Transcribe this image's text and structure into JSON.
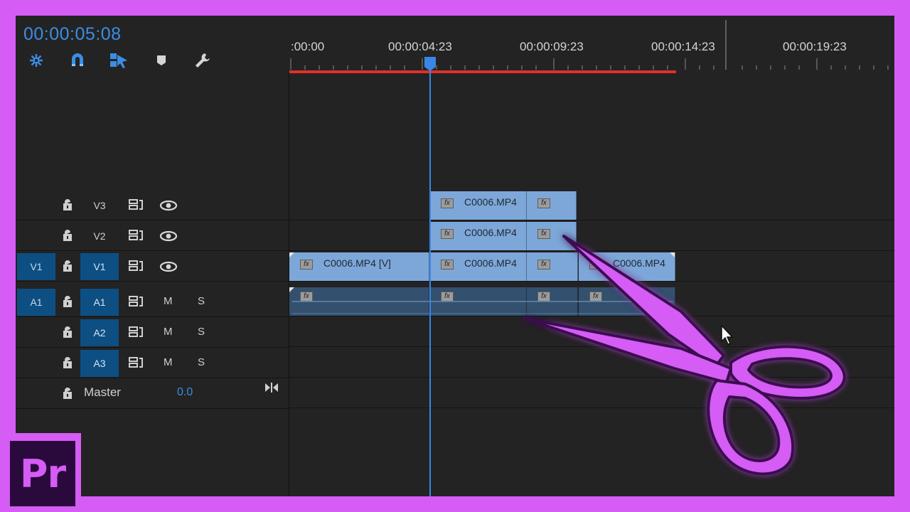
{
  "timecode": "00:00:05:08",
  "toolbar": {
    "icons": [
      "snap-icon",
      "magnet-icon",
      "linked-selection-icon",
      "marker-icon",
      "wrench-icon"
    ]
  },
  "ruler": {
    "labels": [
      ":00:00",
      "00:00:04:23",
      "00:00:09:23",
      "00:00:14:23",
      "00:00:19:23"
    ]
  },
  "tracks": {
    "v3": {
      "name": "V3"
    },
    "v2": {
      "name": "V2"
    },
    "v1": {
      "target": "V1",
      "name": "V1"
    },
    "a1": {
      "target": "A1",
      "name": "A1",
      "m": "M",
      "s": "S"
    },
    "a2": {
      "name": "A2",
      "m": "M",
      "s": "S"
    },
    "a3": {
      "name": "A3",
      "m": "M",
      "s": "S"
    },
    "master": {
      "label": "Master",
      "value": "0.0"
    }
  },
  "clips": {
    "v3_1": "C0006.MP4",
    "v2_1": "C0006.MP4",
    "v1_1": "C0006.MP4 [V]",
    "v1_2": "C0006.MP4",
    "v1_4": "C0006.MP4",
    "fx": "fx"
  },
  "badge": "Pr",
  "colors": {
    "accent": "#3a8ee6",
    "frame": "#d55cf5",
    "video_clip": "#7da7d8",
    "audio_clip": "#33506f",
    "work_area": "#e0312c"
  }
}
